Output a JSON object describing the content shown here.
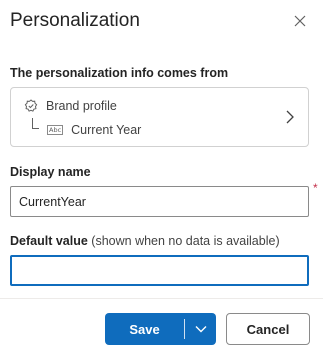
{
  "panel": {
    "title": "Personalization"
  },
  "source": {
    "label": "The personalization info comes from",
    "parent": "Brand profile",
    "child": "Current Year",
    "parent_icon": "brand-profile-icon",
    "child_icon": "text-field-icon"
  },
  "display_name": {
    "label": "Display name",
    "value": "CurrentYear",
    "required_mark": "*"
  },
  "default_value": {
    "label": "Default value",
    "hint": "(shown when no data is available)",
    "value": ""
  },
  "footer": {
    "save_label": "Save",
    "cancel_label": "Cancel"
  },
  "colors": {
    "accent": "#0f6cbd",
    "required": "#c4314b"
  }
}
